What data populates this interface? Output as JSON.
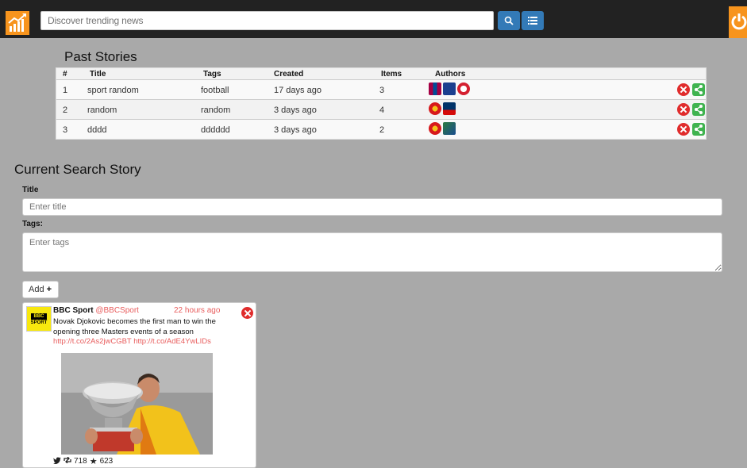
{
  "header": {
    "search_placeholder": "Discover trending news"
  },
  "past_stories": {
    "title": "Past Stories",
    "columns": [
      "#",
      "Title",
      "Tags",
      "Created",
      "Items",
      "Authors"
    ],
    "rows": [
      {
        "num": "1",
        "title": "sport random",
        "tags": "football",
        "created": "17 days ago",
        "items": "3"
      },
      {
        "num": "2",
        "title": "random",
        "tags": "random",
        "created": "3 days ago",
        "items": "4"
      },
      {
        "num": "3",
        "title": "dddd",
        "tags": "dddddd",
        "created": "3 days ago",
        "items": "2"
      }
    ]
  },
  "current_story": {
    "title": "Current Search Story",
    "title_label": "Title",
    "title_placeholder": "Enter title",
    "tags_label": "Tags:",
    "tags_placeholder": "Enter tags",
    "add_label": "Add"
  },
  "tweet": {
    "avatar_top": "BBC",
    "avatar_bottom": "SPORT",
    "name": "BBC Sport",
    "handle": "@BBCSport",
    "time": "22 hours ago",
    "text": "Novak Djokovic becomes the first man to win the opening three Masters events of a season",
    "links": "http://t.co/2As2jwCGBT http://t.co/AdE4YwLIDs",
    "retweets": "718",
    "favorites": "623"
  },
  "colors": {
    "accent_orange": "#f7941d",
    "button_blue": "#337ab7",
    "delete_red": "#e02c2c",
    "share_green": "#3fb34f"
  }
}
